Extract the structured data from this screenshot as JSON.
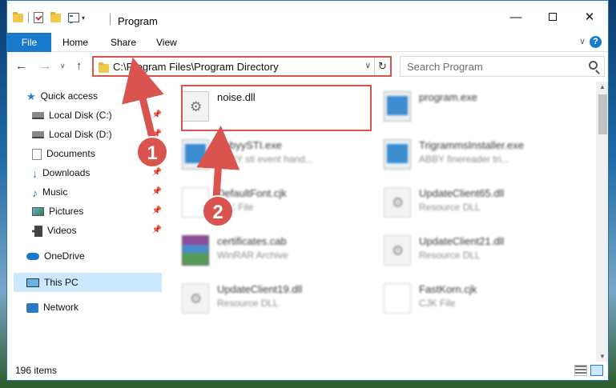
{
  "window": {
    "title": "Program",
    "controls": {
      "minimize": "—",
      "maximize": "",
      "close": "✕"
    }
  },
  "ribbon": {
    "tabs": [
      "File",
      "Home",
      "Share",
      "View"
    ],
    "help": "?"
  },
  "address": {
    "path": "C:\\Program Files\\Program Directory",
    "refresh": "↻",
    "dropdown": "∨"
  },
  "search": {
    "placeholder": "Search Program"
  },
  "nav": {
    "quick_access": "Quick access",
    "items": [
      {
        "label": "Local Disk (C:)",
        "pinned": true
      },
      {
        "label": "Local Disk (D:)",
        "pinned": true
      },
      {
        "label": "Documents",
        "pinned": true
      },
      {
        "label": "Downloads",
        "pinned": true
      },
      {
        "label": "Music",
        "pinned": true
      },
      {
        "label": "Pictures",
        "pinned": true
      },
      {
        "label": "Videos",
        "pinned": true
      }
    ],
    "onedrive": "OneDrive",
    "this_pc": "This PC",
    "network": "Network"
  },
  "files": [
    {
      "name": "noise.dll",
      "desc": "",
      "icon": "gear-icon"
    },
    {
      "name": "program.exe",
      "desc": "",
      "icon": "exe-icon"
    },
    {
      "name": "AbbyySTI.exe",
      "desc": "ABBY sti event hand...",
      "icon": "exe-icon"
    },
    {
      "name": "TrigrammsInstaller.exe",
      "desc": "ABBY finereader tri...",
      "icon": "exe-icon"
    },
    {
      "name": "DefaultFont.cjk",
      "desc": "CJK File",
      "icon": "document-icon"
    },
    {
      "name": "UpdateClient65.dll",
      "desc": "Resource DLL",
      "icon": "gear-icon"
    },
    {
      "name": "certificates.cab",
      "desc": "WinRAR Archive",
      "icon": "archive-icon"
    },
    {
      "name": "UpdateClient21.dll",
      "desc": "Resource DLL",
      "icon": "gear-icon"
    },
    {
      "name": "UpdateClient19.dll",
      "desc": "Resource DLL",
      "icon": "gear-icon"
    },
    {
      "name": "FastKorn.cjk",
      "desc": "CJK File",
      "icon": "document-icon"
    }
  ],
  "status": {
    "items": "196 items"
  },
  "annotations": {
    "step1": "1",
    "step2": "2"
  },
  "colors": {
    "accent": "#1979ca",
    "highlight": "#d9534f",
    "selected": "#cce8ff"
  }
}
